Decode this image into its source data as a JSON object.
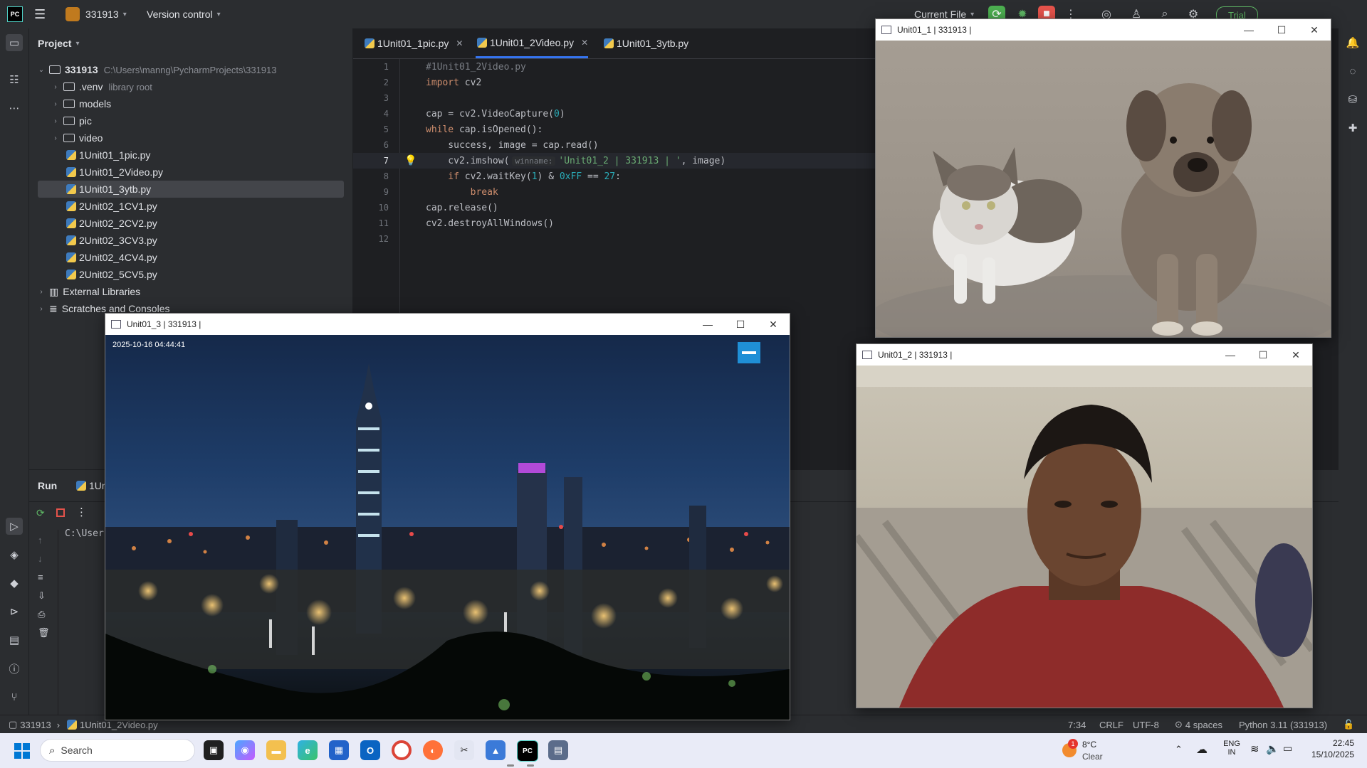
{
  "titlebar": {
    "project_name": "331913",
    "vcs_label": "Version control",
    "run_config": "Current File",
    "trial_label": "Trial"
  },
  "project_panel": {
    "header": "Project",
    "root": {
      "name": "331913",
      "path": "C:\\Users\\manng\\PycharmProjects\\331913"
    },
    "items": [
      {
        "label": ".venv",
        "hint": "library root",
        "type": "folder"
      },
      {
        "label": "models",
        "type": "folder"
      },
      {
        "label": "pic",
        "type": "folder"
      },
      {
        "label": "video",
        "type": "folder"
      },
      {
        "label": "1Unit01_1pic.py",
        "type": "py"
      },
      {
        "label": "1Unit01_2Video.py",
        "type": "py"
      },
      {
        "label": "1Unit01_3ytb.py",
        "type": "py"
      },
      {
        "label": "2Unit02_1CV1.py",
        "type": "py"
      },
      {
        "label": "2Unit02_2CV2.py",
        "type": "py"
      },
      {
        "label": "2Unit02_3CV3.py",
        "type": "py"
      },
      {
        "label": "2Unit02_4CV4.py",
        "type": "py"
      },
      {
        "label": "2Unit02_5CV5.py",
        "type": "py"
      }
    ],
    "external_libraries": "External Libraries",
    "scratches": "Scratches and Consoles"
  },
  "editor": {
    "tabs": [
      {
        "label": "1Unit01_1pic.py"
      },
      {
        "label": "1Unit01_2Video.py"
      },
      {
        "label": "1Unit01_3ytb.py"
      }
    ],
    "lines": {
      "l1": "#1Unit01_2Video.py",
      "l2_kw": "import",
      "l2_rest": " cv2",
      "l4_a": "cap = cv2.VideoCapture(",
      "l4_num": "0",
      "l4_b": ")",
      "l5_kw": "while",
      "l5_rest": " cap.isOpened():",
      "l6": "    success, image = cap.read()",
      "l7_a": "    cv2.imshow(",
      "l7_hint": "winname:",
      "l7_str": "'Unit01_2 | 331913 | '",
      "l7_b": ", image)",
      "l8_kw": "    if",
      "l8_a": " cv2.waitKey(",
      "l8_n1": "1",
      "l8_b": ") & ",
      "l8_n2": "0xFF",
      "l8_c": " == ",
      "l8_n3": "27",
      "l8_d": ":",
      "l9_kw": "        break",
      "l10": "cap.release()",
      "l11": "cv2.destroyAllWindows()"
    }
  },
  "run_panel": {
    "title": "Run",
    "tab_label": "1Un",
    "console_text": "C:\\User"
  },
  "statusbar": {
    "project": "331913",
    "file": "1Unit01_2Video.py",
    "position": "7:34",
    "line_sep": "CRLF",
    "encoding": "UTF-8",
    "indent": "4 spaces",
    "interpreter": "Python 3.11 (331913)"
  },
  "windows": {
    "w1_title": "Unit01_1 | 331913 |",
    "w2_title": "Unit01_2 | 331913 |",
    "w3_title": "Unit01_3 | 331913 |",
    "w3_timestamp": "2025-10-16 04:44:41"
  },
  "taskbar": {
    "search_placeholder": "Search",
    "weather_temp": "8°C",
    "weather_desc": "Clear",
    "weather_alert": "1",
    "lang_top": "ENG",
    "lang_bottom": "IN",
    "time": "22:45",
    "date": "15/10/2025"
  },
  "colors": {
    "accent": "#3574f0",
    "ide_bg": "#1e1f22",
    "panel_bg": "#2b2d30",
    "run_green": "#4caf50",
    "stop_red": "#e5534b"
  }
}
